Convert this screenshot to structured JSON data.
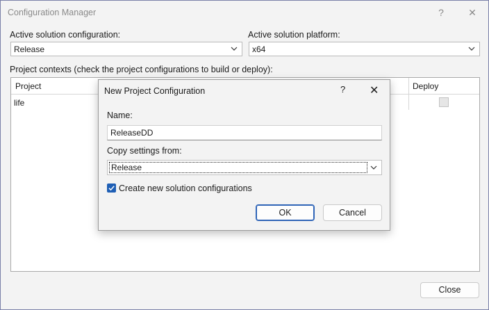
{
  "window": {
    "title": "Configuration Manager",
    "help": "?",
    "close": "✕"
  },
  "config": {
    "active_config_label": "Active solution configuration:",
    "active_config_value": "Release",
    "active_platform_label": "Active solution platform:",
    "active_platform_value": "x64",
    "project_contexts_label": "Project contexts (check the project configurations to build or deploy):"
  },
  "grid": {
    "columns": [
      "Project",
      "Deploy"
    ],
    "rows": [
      {
        "project": "life"
      }
    ]
  },
  "footer": {
    "close_label": "Close"
  },
  "dialog": {
    "title": "New Project Configuration",
    "help": "?",
    "close": "✕",
    "name_label": "Name:",
    "name_value": "ReleaseDD",
    "copy_label": "Copy settings from:",
    "copy_value": "Release",
    "checkbox_label": "Create new solution configurations",
    "checkbox_checked": true,
    "ok_label": "OK",
    "cancel_label": "Cancel"
  },
  "colors": {
    "accent": "#1f5fb5",
    "window_border": "#7a7fa8"
  }
}
